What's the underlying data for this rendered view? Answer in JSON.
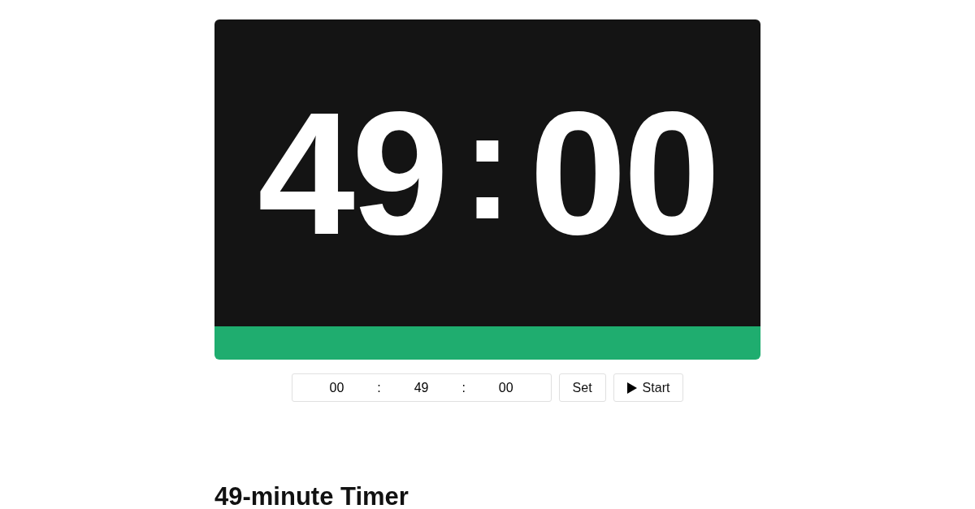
{
  "display": {
    "minutes": "49",
    "separator": ":",
    "seconds": "00"
  },
  "progress": {
    "level": 1
  },
  "time_input": {
    "fields": [
      "00",
      "49",
      "00"
    ],
    "separator": ":"
  },
  "buttons": [
    {
      "kind": "set",
      "label": "Set"
    },
    {
      "kind": "start",
      "label": "Start"
    }
  ],
  "heading": "49-minute Timer"
}
